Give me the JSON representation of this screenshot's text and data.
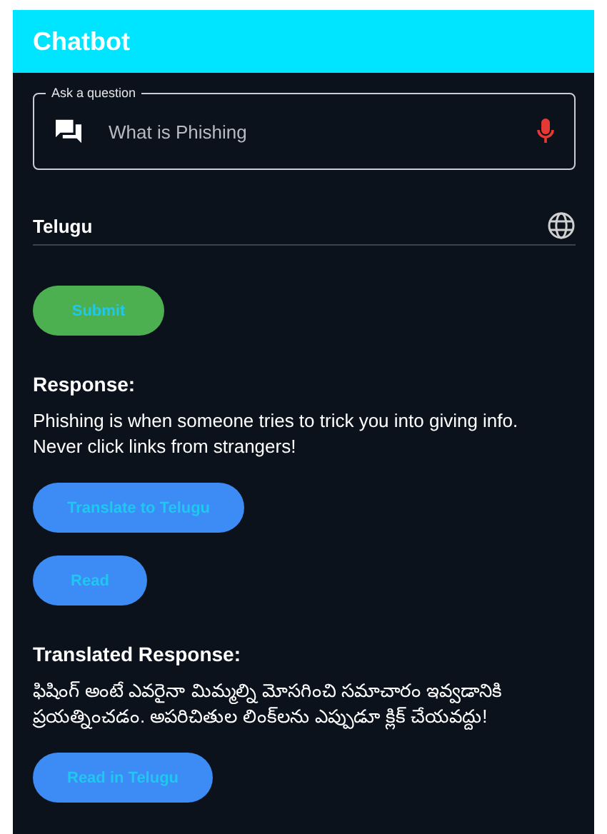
{
  "app_bar": {
    "title": "Chatbot"
  },
  "question_field": {
    "label": "Ask a question",
    "value": "What is Phishing"
  },
  "language_field": {
    "value": "Telugu"
  },
  "content": [
    {
      "kind": "button",
      "label": "Submit",
      "color": "#4caf50"
    },
    {
      "kind": "heading",
      "text": "Response:"
    },
    {
      "kind": "paragraph",
      "text": "Phishing is when someone tries to trick you into giving info. Never click links from strangers!"
    },
    {
      "kind": "button",
      "label": "Translate to Telugu",
      "color": "#3d8bf5"
    },
    {
      "kind": "button",
      "label": "Read",
      "color": "#3d8bf5"
    },
    {
      "kind": "heading",
      "text": "Translated Response:"
    },
    {
      "kind": "paragraph",
      "text": "ఫిషింగ్ అంటే ఎవరైనా మిమ్మల్ని మోసగించి సమాచారం ఇవ్వడానికి ప్రయత్నించడం. అపరిచితుల లింక్‌లను ఎప్పుడూ క్లిక్ చేయవద్దు!"
    },
    {
      "kind": "button",
      "label": "Read in Telugu",
      "color": "#3d8bf5"
    }
  ]
}
